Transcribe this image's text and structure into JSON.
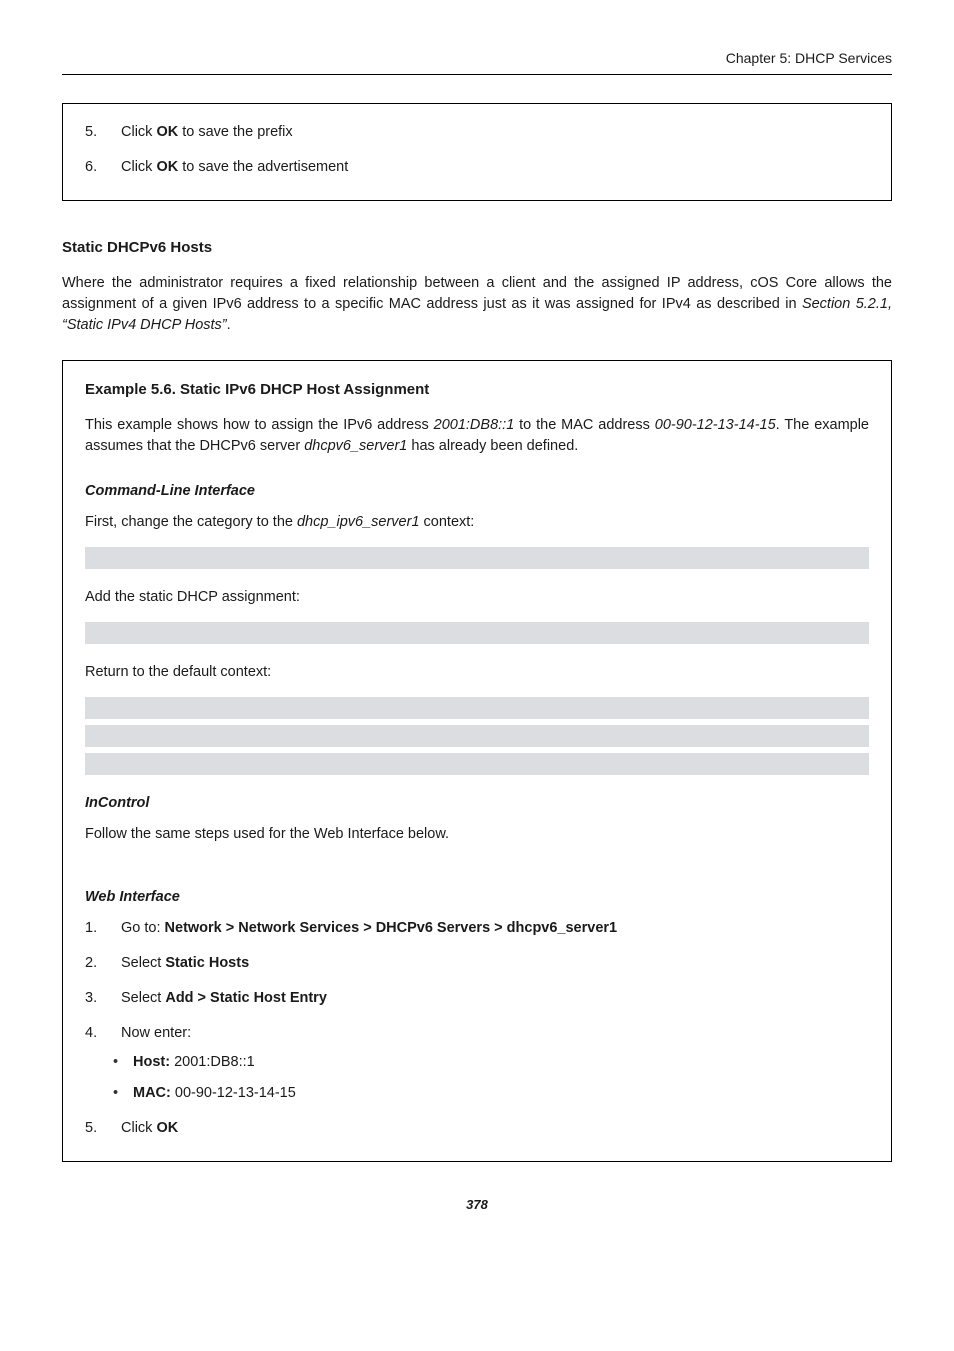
{
  "header": {
    "chapter": "Chapter 5: DHCP Services"
  },
  "topbox": {
    "steps": [
      {
        "n": "5.",
        "pre": "Click ",
        "bold": "OK",
        "post": " to save the prefix"
      },
      {
        "n": "6.",
        "pre": "Click ",
        "bold": "OK",
        "post": " to save the advertisement"
      }
    ]
  },
  "section": {
    "title": "Static DHCPv6 Hosts",
    "para_pre": "Where the administrator requires a fixed relationship between a client and the assigned IP address, cOS Core allows the assignment of a given IPv6 address to a specific MAC address just as it was assigned for IPv4 as described in ",
    "para_ref": "Section 5.2.1, “Static IPv4 DHCP Hosts”",
    "para_post": "."
  },
  "example": {
    "title": "Example 5.6. Static IPv6 DHCP Host Assignment",
    "intro_a": "This example shows how to assign the IPv6 address ",
    "addr": "2001:DB8::1",
    "intro_b": " to the MAC address ",
    "mac": "00-90-12-13-14-15",
    "intro_c": ". The example assumes that the DHCPv6 server ",
    "srv": "dhcpv6_server1",
    "intro_d": " has already been defined.",
    "cli_heading": "Command-Line Interface",
    "cli_line1_a": "First, change the category to the ",
    "cli_line1_i": "dhcp_ipv6_server1",
    "cli_line1_b": " context:",
    "cli_line2": "Add the static DHCP assignment:",
    "cli_line3": "Return to the default context:",
    "incontrol_heading": "InControl",
    "incontrol_text": "Follow the same steps used for the Web Interface below.",
    "web_heading": "Web Interface",
    "steps": [
      {
        "n": "1.",
        "pre": "Go to: ",
        "bold": "Network > Network Services > DHCPv6 Servers > dhcpv6_server1"
      },
      {
        "n": "2.",
        "pre": "Select ",
        "bold": "Static Hosts"
      },
      {
        "n": "3.",
        "pre": "Select ",
        "bold": "Add > Static Host Entry"
      },
      {
        "n": "4.",
        "pre": "Now enter:",
        "sub": [
          {
            "bold": "Host:",
            "post": " 2001:DB8::1"
          },
          {
            "bold": "MAC:",
            "post": " 00-90-12-13-14-15"
          }
        ]
      },
      {
        "n": "5.",
        "pre": "Click ",
        "bold": "OK"
      }
    ]
  },
  "footer": {
    "page": "378"
  }
}
